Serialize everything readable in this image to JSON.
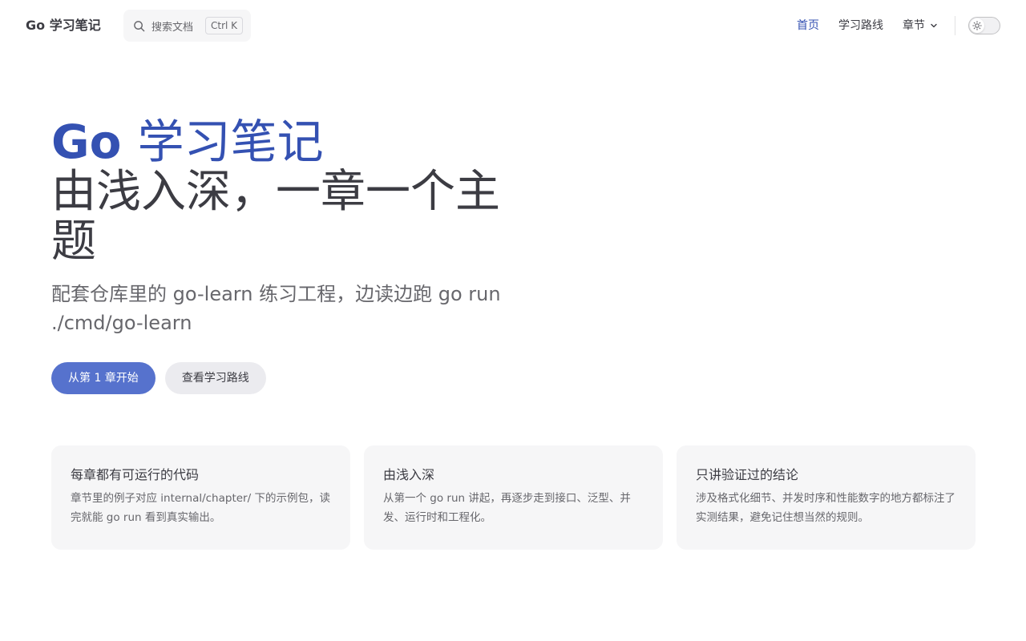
{
  "nav": {
    "brand": "Go 学习笔记",
    "search": {
      "label": "搜索文档",
      "shortcut": "Ctrl K"
    },
    "links": [
      {
        "label": "首页",
        "active": true
      },
      {
        "label": "学习路线",
        "active": false
      }
    ],
    "dropdown": {
      "label": "章节"
    },
    "theme_toggle": {
      "icon": "sun-icon"
    }
  },
  "hero": {
    "name_prefix": "Go",
    "name_suffix": "学习笔记",
    "text": "由浅入深，一章一个主题",
    "tagline": "配套仓库里的 go-learn 练习工程，边读边跑 go run ./cmd/go-learn",
    "actions": [
      {
        "label": "从第 1 章开始",
        "theme": "brand"
      },
      {
        "label": "查看学习路线",
        "theme": "alt"
      }
    ]
  },
  "features": [
    {
      "title": "每章都有可运行的代码",
      "details": "章节里的例子对应 internal/chapter/ 下的示例包，读完就能 go run 看到真实输出。"
    },
    {
      "title": "由浅入深",
      "details": "从第一个 go run 讲起，再逐步走到接口、泛型、并发、运行时和工程化。"
    },
    {
      "title": "只讲验证过的结论",
      "details": "涉及格式化细节、并发时序和性能数字的地方都标注了实测结果，避免记住想当然的规则。"
    }
  ],
  "colors": {
    "brand": "#3451b2",
    "button_brand": "#5672cd",
    "text": "#3c3c43",
    "muted": "#67676c",
    "card_bg": "#f6f6f7"
  }
}
